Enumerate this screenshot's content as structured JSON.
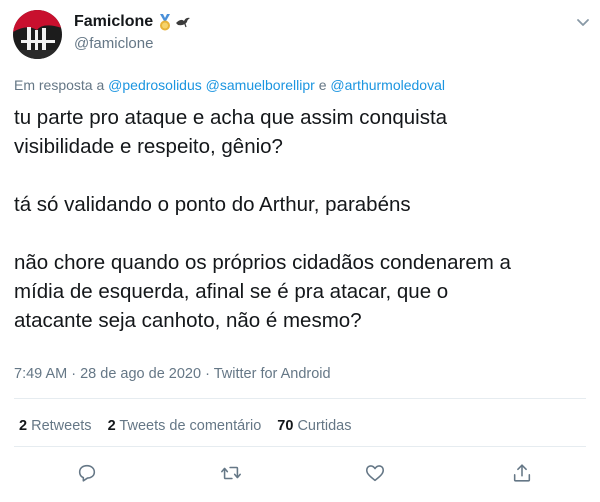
{
  "user": {
    "display_name": "Famiclone",
    "handle": "@famiclone",
    "badge_icons": [
      "medal-icon",
      "bird-icon"
    ]
  },
  "reply_to": {
    "prefix": "Em resposta a",
    "mention_1": "@pedrosolidus",
    "mention_2": "@samuelborellipr",
    "conjunction": "e",
    "mention_3": "@arthurmoledoval"
  },
  "tweet": {
    "line_1": "tu parte pro ataque e acha que assim conquista",
    "line_2": "visibilidade e respeito, gênio?",
    "line_3": "tá só validando o ponto do Arthur, parabéns",
    "line_4": "não chore quando os próprios cidadãos condenarem a",
    "line_5": "mídia de esquerda, afinal se é pra atacar, que o",
    "line_6": "atacante seja canhoto, não é mesmo?"
  },
  "meta": {
    "time": "7:49 AM",
    "separator_1": "·",
    "date": "28 de ago de 2020",
    "separator_2": "·",
    "source": "Twitter for Android"
  },
  "stats": {
    "retweets_count": "2",
    "retweets_label": "Retweets",
    "comments_count": "2",
    "comments_label": "Tweets de comentário",
    "likes_count": "70",
    "likes_label": "Curtidas"
  },
  "actions": [
    "reply-icon",
    "retweet-icon",
    "like-icon",
    "share-icon"
  ],
  "colors": {
    "text": "#14171a",
    "secondary": "#657786",
    "link": "#1b95e0",
    "divider": "#e6ecf0"
  }
}
